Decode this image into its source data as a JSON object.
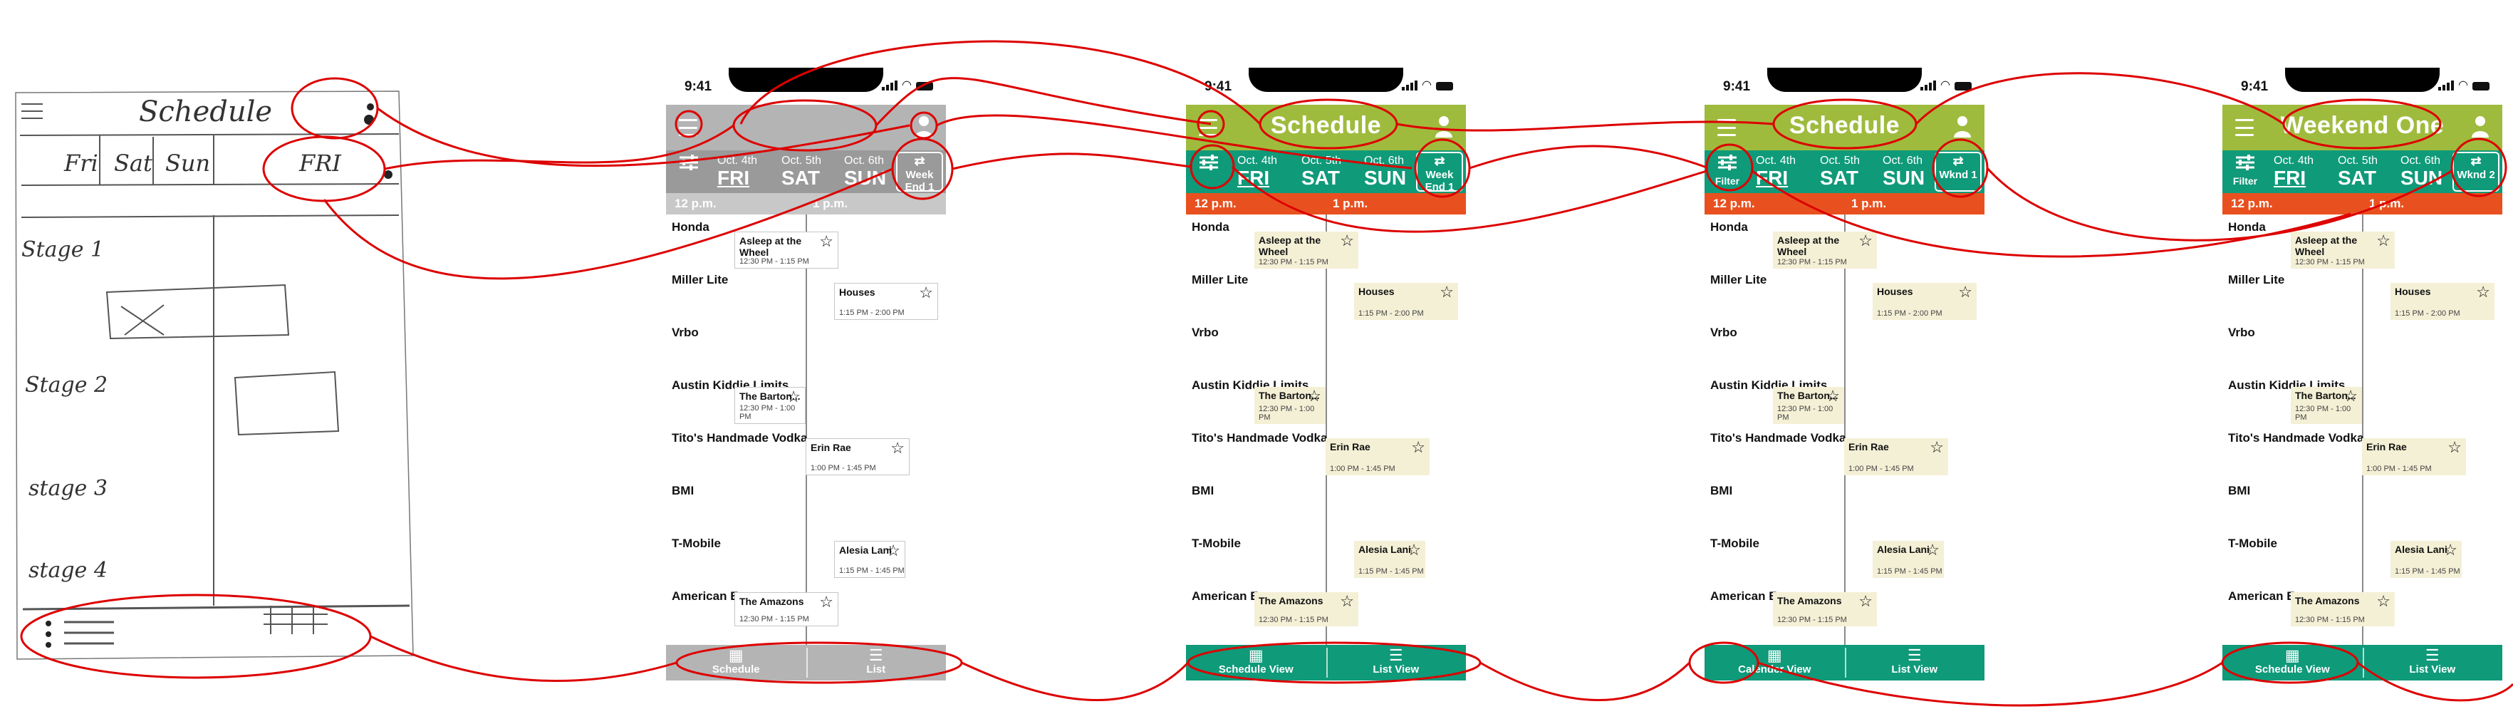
{
  "sketch": {
    "title": "Schedule",
    "days": [
      "Fri",
      "Sat",
      "Sun",
      "FRI"
    ],
    "stages": [
      "Stage 1",
      "Stage 2",
      "stage 3",
      "stage 4"
    ]
  },
  "status_time": "9:41",
  "colors": {
    "green": "#9fbb3d",
    "teal": "#0f9a7a",
    "orange": "#e8511f",
    "grey": "#b4b4b4",
    "cream": "#f4f0d6",
    "annotation": "#dd0000"
  },
  "screens": [
    {
      "style": "grey",
      "title": "",
      "filter_label": "",
      "days": [
        {
          "date": "Oct. 4th",
          "name": "FRI"
        },
        {
          "date": "Oct. 5th",
          "name": "SAT"
        },
        {
          "date": "Oct. 6th",
          "name": "SUN"
        }
      ],
      "week_button": "Week End 1",
      "times": [
        "12 p.m.",
        "1 p.m."
      ],
      "tabs": [
        "Schedule",
        "List"
      ]
    },
    {
      "style": "color",
      "title": "Schedule",
      "filter_label": "",
      "days": [
        {
          "date": "Oct. 4th",
          "name": "FRI"
        },
        {
          "date": "Oct. 5th",
          "name": "SAT"
        },
        {
          "date": "Oct. 6th",
          "name": "SUN"
        }
      ],
      "week_button": "Week End 1",
      "times": [
        "12 p.m.",
        "1 p.m."
      ],
      "tabs": [
        "Schedule View",
        "List  View"
      ]
    },
    {
      "style": "color",
      "title": "Schedule",
      "filter_label": "Filter",
      "days": [
        {
          "date": "Oct. 4th",
          "name": "FRI"
        },
        {
          "date": "Oct. 5th",
          "name": "SAT"
        },
        {
          "date": "Oct. 6th",
          "name": "SUN"
        }
      ],
      "week_button": "Wknd 1",
      "times": [
        "12 p.m.",
        "1 p.m."
      ],
      "tabs": [
        "Calender View",
        "List  View"
      ]
    },
    {
      "style": "color",
      "title": "Weekend One",
      "filter_label": "Filter",
      "days": [
        {
          "date": "Oct. 4th",
          "name": "FRI"
        },
        {
          "date": "Oct. 5th",
          "name": "SAT"
        },
        {
          "date": "Oct. 6th",
          "name": "SUN"
        }
      ],
      "week_button": "Wknd 2",
      "times": [
        "12 p.m.",
        "1 p.m."
      ],
      "tabs": [
        "Schedule View",
        "List  View"
      ]
    }
  ],
  "stages": [
    "Honda",
    "Miller Lite",
    "Vrbo",
    "Austin Kiddie Limits",
    "Tito's Handmade Vodka",
    "BMI",
    "T-Mobile",
    "American Express"
  ],
  "performances": [
    {
      "name": "Asleep at the Wheel",
      "time": "12:30 PM - 1:15 PM",
      "stage": 0
    },
    {
      "name": "Houses",
      "time": "1:15 PM - 2:00 PM",
      "stage": 1
    },
    {
      "name": "The Barton...",
      "time": "12:30 PM - 1:00 PM",
      "stage": 3
    },
    {
      "name": "Erin Rae",
      "time": "1:00 PM - 1:45 PM",
      "stage": 4
    },
    {
      "name": "Alesia Lani",
      "time": "1:15 PM - 1:45 PM",
      "stage": 6
    },
    {
      "name": "The Amazons",
      "time": "12:30 PM - 1:15 PM",
      "stage": 7
    }
  ]
}
